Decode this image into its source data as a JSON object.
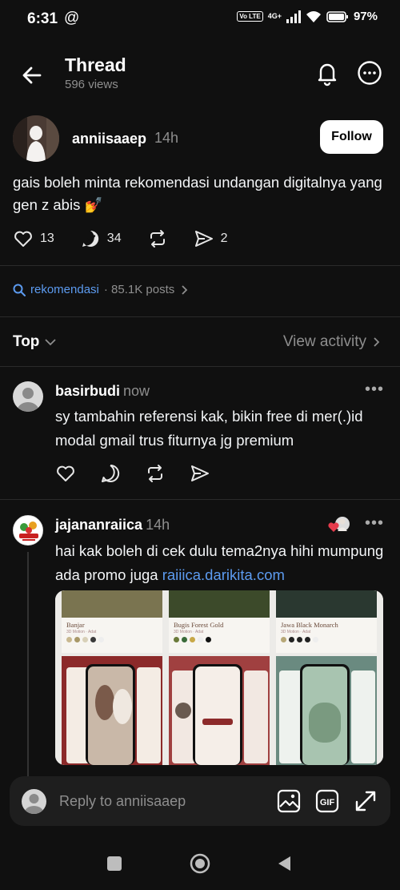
{
  "status_bar": {
    "time": "6:31",
    "threads_glyph": "@",
    "volte": "Vo LTE",
    "network": "4G+",
    "battery": "97%"
  },
  "header": {
    "title": "Thread",
    "views": "596 views"
  },
  "post": {
    "username": "anniisaaep",
    "time": "14h",
    "follow_label": "Follow",
    "text": "gais boleh minta rekomendasi undangan digitalnya yang gen z abis 💅",
    "likes": "13",
    "replies": "34",
    "shares": "2"
  },
  "topic": {
    "name": "rekomendasi",
    "posts": "· 85.1K posts"
  },
  "sort": {
    "label": "Top",
    "view_activity": "View activity"
  },
  "replies": [
    {
      "username": "basirbudi",
      "time": "now",
      "text": "sy tambahin referensi kak, bikin free di mer(.)id modal gmail trus fiturnya jg premium"
    },
    {
      "username": "jajananraiica",
      "time": "14h",
      "text": "hai kak boleh di cek dulu tema2nya hihi mumpung ada promo juga",
      "link": "raiiica.darikita.com"
    }
  ],
  "media": {
    "cards": [
      {
        "title": "Banjar",
        "sub": "3D Motion · Adat"
      },
      {
        "title": "Bugis Forest Gold",
        "sub": "3D Motion · Adat"
      },
      {
        "title": "Jawa Black Monarch",
        "sub": "3D Motion · Adat"
      }
    ]
  },
  "reply_bar": {
    "placeholder": "Reply to anniisaaep"
  },
  "colors": {
    "background": "#101010",
    "accent_link": "#5c9bf0",
    "muted": "#8e8e8e"
  }
}
